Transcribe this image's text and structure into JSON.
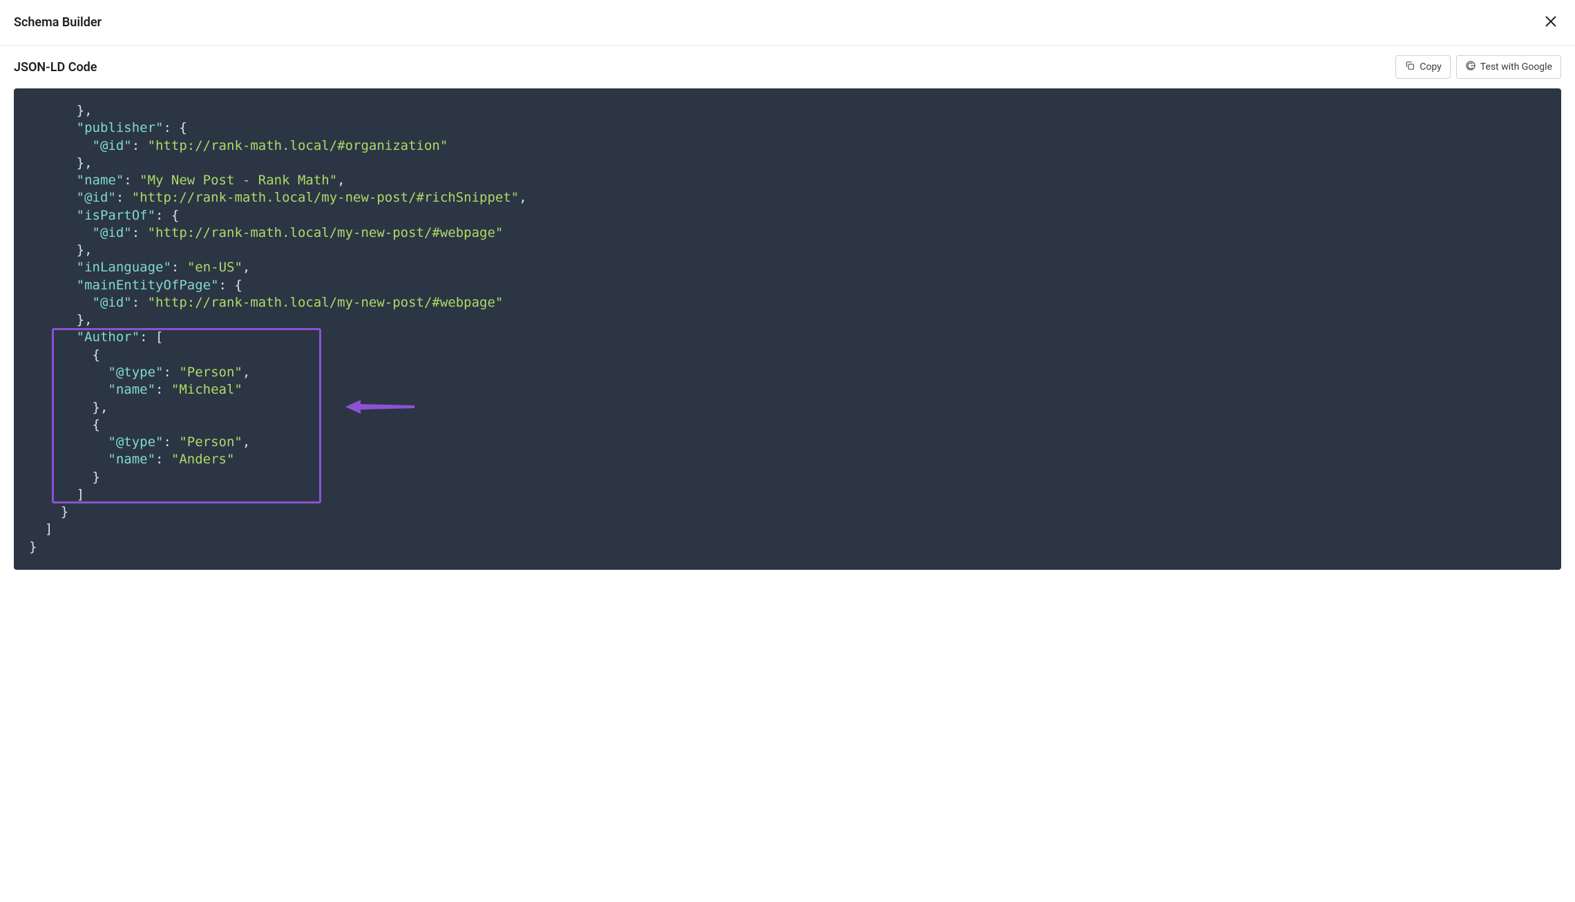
{
  "header": {
    "title": "Schema Builder"
  },
  "subheader": {
    "title": "JSON-LD Code",
    "copy_label": "Copy",
    "test_google_label": "Test with Google"
  },
  "code": {
    "lines": [
      {
        "indent": 6,
        "tokens": [
          {
            "type": "punc",
            "text": "},"
          }
        ]
      },
      {
        "indent": 6,
        "tokens": [
          {
            "type": "key",
            "text": "\"publisher\""
          },
          {
            "type": "punc",
            "text": ": {"
          }
        ]
      },
      {
        "indent": 8,
        "tokens": [
          {
            "type": "key",
            "text": "\"@id\""
          },
          {
            "type": "punc",
            "text": ": "
          },
          {
            "type": "str",
            "text": "\"http://rank-math.local/#organization\""
          }
        ]
      },
      {
        "indent": 6,
        "tokens": [
          {
            "type": "punc",
            "text": "},"
          }
        ]
      },
      {
        "indent": 6,
        "tokens": [
          {
            "type": "key",
            "text": "\"name\""
          },
          {
            "type": "punc",
            "text": ": "
          },
          {
            "type": "str",
            "text": "\"My New Post - Rank Math\""
          },
          {
            "type": "punc",
            "text": ","
          }
        ]
      },
      {
        "indent": 6,
        "tokens": [
          {
            "type": "key",
            "text": "\"@id\""
          },
          {
            "type": "punc",
            "text": ": "
          },
          {
            "type": "str",
            "text": "\"http://rank-math.local/my-new-post/#richSnippet\""
          },
          {
            "type": "punc",
            "text": ","
          }
        ]
      },
      {
        "indent": 6,
        "tokens": [
          {
            "type": "key",
            "text": "\"isPartOf\""
          },
          {
            "type": "punc",
            "text": ": {"
          }
        ]
      },
      {
        "indent": 8,
        "tokens": [
          {
            "type": "key",
            "text": "\"@id\""
          },
          {
            "type": "punc",
            "text": ": "
          },
          {
            "type": "str",
            "text": "\"http://rank-math.local/my-new-post/#webpage\""
          }
        ]
      },
      {
        "indent": 6,
        "tokens": [
          {
            "type": "punc",
            "text": "},"
          }
        ]
      },
      {
        "indent": 6,
        "tokens": [
          {
            "type": "key",
            "text": "\"inLanguage\""
          },
          {
            "type": "punc",
            "text": ": "
          },
          {
            "type": "str",
            "text": "\"en-US\""
          },
          {
            "type": "punc",
            "text": ","
          }
        ]
      },
      {
        "indent": 6,
        "tokens": [
          {
            "type": "key",
            "text": "\"mainEntityOfPage\""
          },
          {
            "type": "punc",
            "text": ": {"
          }
        ]
      },
      {
        "indent": 8,
        "tokens": [
          {
            "type": "key",
            "text": "\"@id\""
          },
          {
            "type": "punc",
            "text": ": "
          },
          {
            "type": "str",
            "text": "\"http://rank-math.local/my-new-post/#webpage\""
          }
        ]
      },
      {
        "indent": 6,
        "tokens": [
          {
            "type": "punc",
            "text": "},"
          }
        ]
      },
      {
        "indent": 6,
        "tokens": [
          {
            "type": "key",
            "text": "\"Author\""
          },
          {
            "type": "punc",
            "text": ": ["
          }
        ]
      },
      {
        "indent": 8,
        "tokens": [
          {
            "type": "punc",
            "text": "{"
          }
        ]
      },
      {
        "indent": 10,
        "tokens": [
          {
            "type": "key",
            "text": "\"@type\""
          },
          {
            "type": "punc",
            "text": ": "
          },
          {
            "type": "str",
            "text": "\"Person\""
          },
          {
            "type": "punc",
            "text": ","
          }
        ]
      },
      {
        "indent": 10,
        "tokens": [
          {
            "type": "key",
            "text": "\"name\""
          },
          {
            "type": "punc",
            "text": ": "
          },
          {
            "type": "str",
            "text": "\"Micheal\""
          }
        ]
      },
      {
        "indent": 8,
        "tokens": [
          {
            "type": "punc",
            "text": "},"
          }
        ]
      },
      {
        "indent": 8,
        "tokens": [
          {
            "type": "punc",
            "text": "{"
          }
        ]
      },
      {
        "indent": 10,
        "tokens": [
          {
            "type": "key",
            "text": "\"@type\""
          },
          {
            "type": "punc",
            "text": ": "
          },
          {
            "type": "str",
            "text": "\"Person\""
          },
          {
            "type": "punc",
            "text": ","
          }
        ]
      },
      {
        "indent": 10,
        "tokens": [
          {
            "type": "key",
            "text": "\"name\""
          },
          {
            "type": "punc",
            "text": ": "
          },
          {
            "type": "str",
            "text": "\"Anders\""
          }
        ]
      },
      {
        "indent": 8,
        "tokens": [
          {
            "type": "punc",
            "text": "}"
          }
        ]
      },
      {
        "indent": 6,
        "tokens": [
          {
            "type": "punc",
            "text": "]"
          }
        ]
      },
      {
        "indent": 4,
        "tokens": [
          {
            "type": "punc",
            "text": "}"
          }
        ]
      },
      {
        "indent": 2,
        "tokens": [
          {
            "type": "punc",
            "text": "]"
          }
        ]
      },
      {
        "indent": 0,
        "tokens": [
          {
            "type": "punc",
            "text": "}"
          }
        ]
      }
    ]
  },
  "annotations": {
    "highlight_color": "#8c52d3",
    "arrow_color": "#8c52d3"
  }
}
